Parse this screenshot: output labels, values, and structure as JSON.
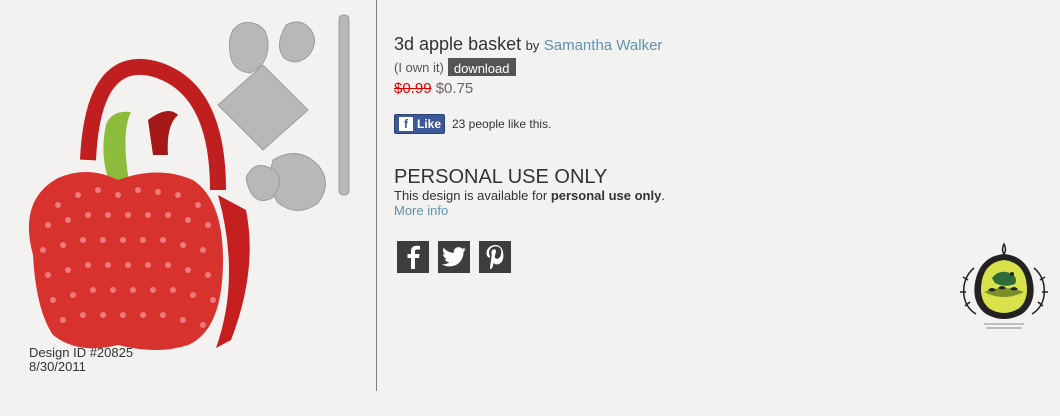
{
  "design": {
    "id_label": "Design ID #20825",
    "date": "8/30/2011"
  },
  "product": {
    "title": "3d apple basket",
    "by_label": "by",
    "author": "Samantha Walker",
    "own_text": "(I own it)",
    "download_label": "download",
    "old_price": "$0.99",
    "new_price": "$0.75"
  },
  "like": {
    "button_label": "Like",
    "count_text": "23 people like this."
  },
  "license": {
    "heading": "PERSONAL USE ONLY",
    "desc_prefix": "This design is available for ",
    "desc_bold": "personal use only",
    "desc_suffix": ".",
    "more_info": "More info"
  },
  "social": {
    "icons": [
      "facebook-icon",
      "twitter-icon",
      "pinterest-icon"
    ]
  },
  "colors": {
    "accent_link": "#5d93ad",
    "old_price": "#e10000",
    "facebook": "#3b5998",
    "apple_red": "#d8322f",
    "leaf_green": "#8dbb3b"
  }
}
